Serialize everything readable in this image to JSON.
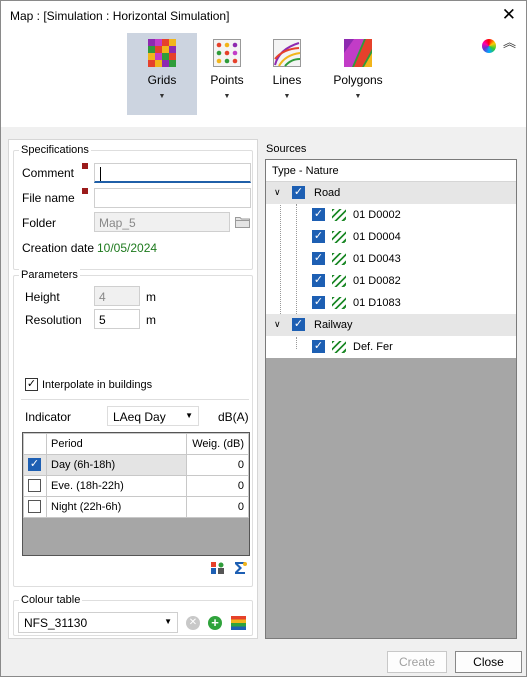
{
  "window": {
    "title": "Map :  [Simulation : Horizontal Simulation]"
  },
  "ribbon": {
    "buttons": [
      {
        "label": "Grids"
      },
      {
        "label": "Points"
      },
      {
        "label": "Lines"
      },
      {
        "label": "Polygons"
      }
    ],
    "dropdown_glyph": "▼"
  },
  "specifications": {
    "legend": "Specifications",
    "comment_label": "Comment",
    "comment_value": "",
    "filename_label": "File name",
    "filename_value": "",
    "folder_label": "Folder",
    "folder_value": "Map_5",
    "creation_label": "Creation date",
    "creation_value": "10/05/2024"
  },
  "parameters": {
    "legend": "Parameters",
    "height_label": "Height",
    "height_value": "4",
    "height_unit": "m",
    "resolution_label": "Resolution",
    "resolution_value": "5",
    "resolution_unit": "m",
    "interpolate_label": "Interpolate in buildings",
    "indicator_label": "Indicator",
    "indicator_value": "LAeq Day",
    "indicator_unit": "dB(A)"
  },
  "periods": {
    "headers": [
      "Period",
      "Weig. (dB)"
    ],
    "rows": [
      {
        "period": "Day (6h-18h)",
        "weight": "0",
        "checked": true
      },
      {
        "period": "Eve. (18h-22h)",
        "weight": "0",
        "checked": false
      },
      {
        "period": "Night (22h-6h)",
        "weight": "0",
        "checked": false
      }
    ]
  },
  "colour_table": {
    "legend": "Colour table",
    "value": "NFS_31130"
  },
  "sources": {
    "title": "Sources",
    "column_header": "Type - Nature",
    "groups": [
      {
        "name": "Road",
        "items": [
          "01 D0002",
          "01 D0004",
          "01 D0043",
          "01 D0082",
          "01 D1083"
        ]
      },
      {
        "name": "Railway",
        "items": [
          "Def. Fer"
        ]
      }
    ]
  },
  "buttons": {
    "create": "Create",
    "close": "Close"
  },
  "colors": {
    "accent": "#1d5fb3",
    "hatch": "#1f8a2a",
    "date": "#1e7a1e",
    "required": "#9b1b1b"
  }
}
